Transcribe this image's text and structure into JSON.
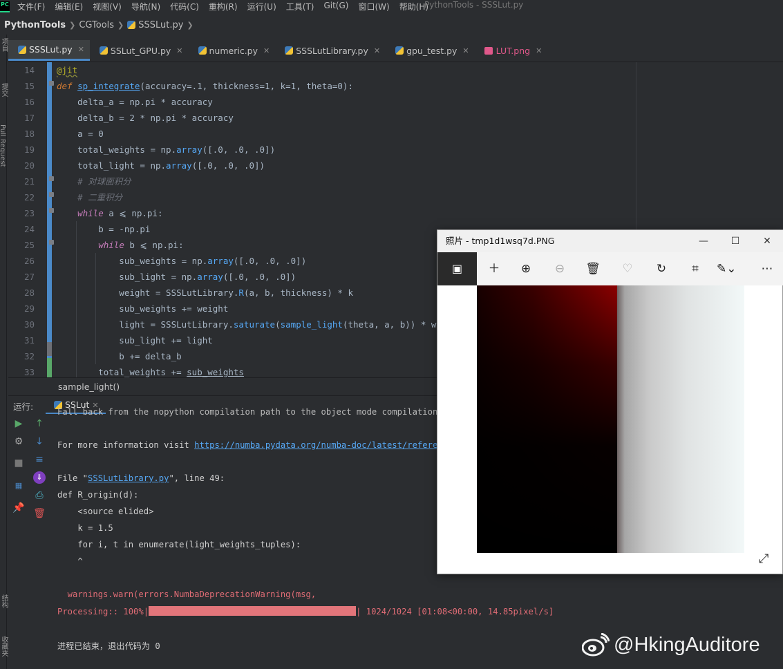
{
  "menu": {
    "items": [
      "文件(F)",
      "编辑(E)",
      "视图(V)",
      "导航(N)",
      "代码(C)",
      "重构(R)",
      "运行(U)",
      "工具(T)",
      "Git(G)",
      "窗口(W)",
      "帮助(H)"
    ],
    "window_title": "PythonTools - SSSLut.py"
  },
  "breadcrumb": {
    "project": "PythonTools",
    "folder": "CGTools",
    "file": "SSSLut.py"
  },
  "left_strip": {
    "labels": [
      "项目",
      "提交",
      "Pull Request",
      "结构",
      "收藏夹"
    ]
  },
  "tabs": [
    {
      "label": "SSSLut.py",
      "kind": "py",
      "active": true
    },
    {
      "label": "SSLut_GPU.py",
      "kind": "py"
    },
    {
      "label": "numeric.py",
      "kind": "py"
    },
    {
      "label": "SSSLutLibrary.py",
      "kind": "py"
    },
    {
      "label": "gpu_test.py",
      "kind": "py"
    },
    {
      "label": "LUT.png",
      "kind": "png"
    }
  ],
  "editor": {
    "line_numbers": [
      "14",
      "15",
      "16",
      "17",
      "18",
      "19",
      "20",
      "21",
      "22",
      "23",
      "24",
      "25",
      "26",
      "27",
      "28",
      "29",
      "30",
      "31",
      "32",
      "33"
    ],
    "breadcrumb": "sample_light()"
  },
  "run": {
    "label": "运行:",
    "tab": "SSLut",
    "console": {
      "line0": "Fall back from the nopython compilation path to the object mode compilation pa",
      "info_prefix": "For more information visit ",
      "info_link": "https://numba.pydata.org/numba-doc/latest/reference/",
      "file_prefix": "File \"",
      "file_link": "SSSLutLibrary.py",
      "file_suffix": "\", line 49:",
      "def_line": "def R_origin(d):",
      "elided": "    <source elided>",
      "k_line": "    k = 1.5",
      "for_line": "    for i, t in enumerate(light_weights_tuples):",
      "caret": "    ^",
      "warn": "  warnings.warn(errors.NumbaDeprecationWarning(msg,",
      "progress_prefix": "Processing:: 100%|",
      "progress_value": 1.0,
      "progress_suffix": "| 1024/1024 [01:08<00:00, 14.85pixel/s]",
      "exit": "进程已结束，退出代码为 0"
    }
  },
  "photos": {
    "title": "照片 - tmp1d1wsq7d.PNG",
    "toolbar": [
      "image-icon",
      "add-icon",
      "zoom-in-icon",
      "zoom-out-icon",
      "delete-icon",
      "heart-icon",
      "rotate-icon",
      "crop-icon",
      "edit-icon",
      "more-icon"
    ]
  },
  "watermark": "@HkingAuditore"
}
